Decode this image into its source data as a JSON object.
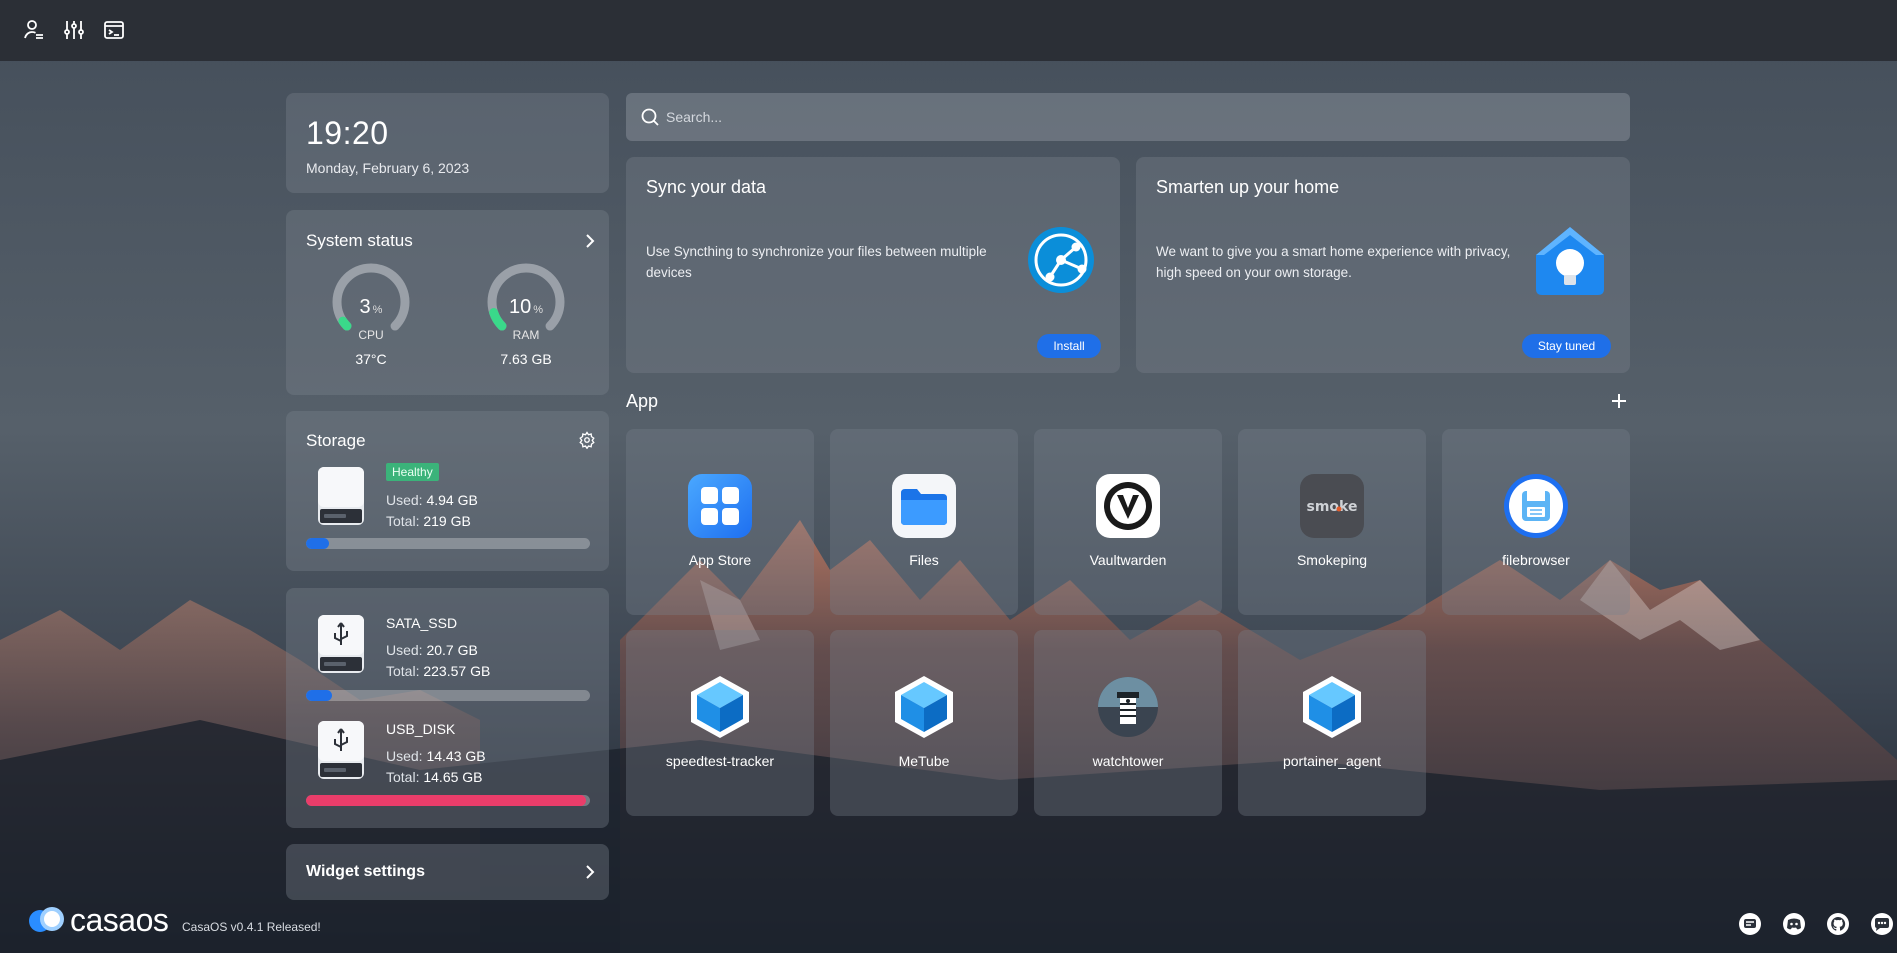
{
  "clock": {
    "time": "19:20",
    "date": "Monday, February 6, 2023"
  },
  "system_status": {
    "title": "System status",
    "cpu": {
      "percent": 3,
      "unit": "%",
      "label": "CPU",
      "sub": "37°C"
    },
    "ram": {
      "percent": 10,
      "unit": "%",
      "label": "RAM",
      "sub": "7.63 GB"
    }
  },
  "storage": {
    "title": "Storage",
    "status": "Healthy",
    "used_label": "Used:",
    "total_label": "Total:",
    "used": "4.94 GB",
    "total": "219 GB",
    "usage_fraction": 0.08
  },
  "disks": [
    {
      "name": "SATA_SSD",
      "used": "20.7 GB",
      "total": "223.57 GB",
      "usage_fraction": 0.093,
      "color": "#1f6fe8"
    },
    {
      "name": "USB_DISK",
      "used": "14.43 GB",
      "total": "14.65 GB",
      "usage_fraction": 0.985,
      "color": "#ea3d6a"
    }
  ],
  "widget_settings": {
    "label": "Widget settings"
  },
  "search": {
    "placeholder": "Search..."
  },
  "promos": [
    {
      "title": "Sync your data",
      "description": "Use Syncthing to synchronize your files between multiple devices",
      "button": "Install",
      "icon": "syncthing-icon"
    },
    {
      "title": "Smarten up your home",
      "description": "We want to give you a smart home experience with privacy, high speed on your own storage.",
      "button": "Stay tuned",
      "icon": "smart-home-icon"
    }
  ],
  "apps_section": {
    "label": "App"
  },
  "apps": [
    {
      "name": "App Store",
      "icon": "app-store-icon"
    },
    {
      "name": "Files",
      "icon": "files-icon"
    },
    {
      "name": "Vaultwarden",
      "icon": "vaultwarden-icon"
    },
    {
      "name": "Smokeping",
      "icon": "smokeping-icon",
      "icon_text": "smoke"
    },
    {
      "name": "filebrowser",
      "icon": "filebrowser-icon"
    },
    {
      "name": "speedtest-tracker",
      "icon": "cube-icon"
    },
    {
      "name": "MeTube",
      "icon": "cube-icon"
    },
    {
      "name": "watchtower",
      "icon": "watchtower-icon"
    },
    {
      "name": "portainer_agent",
      "icon": "cube-icon"
    }
  ],
  "footer": {
    "brand": "casaos",
    "release": "CasaOS v0.4.1 Released!",
    "icons": [
      "message-icon",
      "discord-icon",
      "github-icon",
      "chat-icon"
    ]
  },
  "colors": {
    "accent": "#1f6fe8",
    "healthy": "#3bb37a",
    "danger": "#ea3d6a",
    "gauge_ok": "#3ad98a"
  }
}
